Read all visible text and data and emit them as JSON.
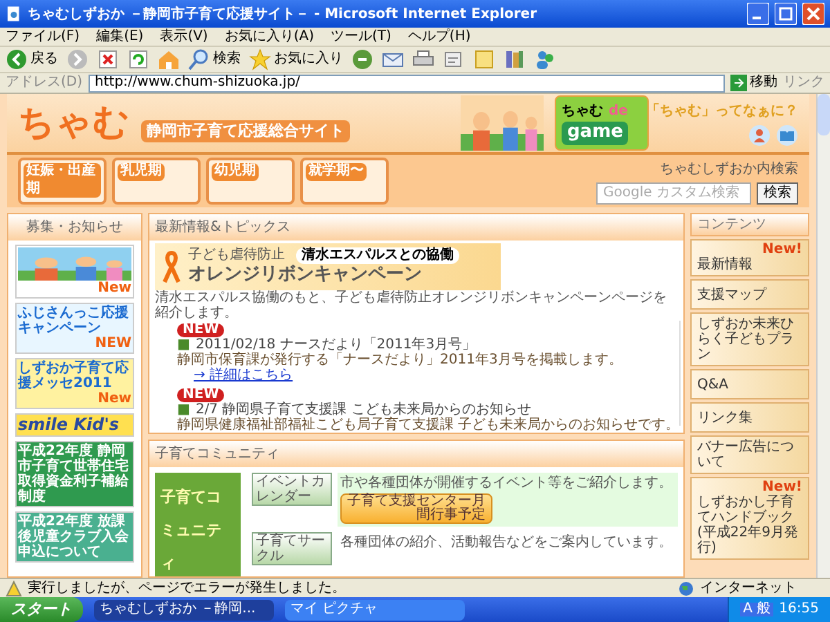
{
  "window": {
    "title": "ちゃむしずおか －静岡市子育て応援サイト－ - Microsoft Internet Explorer"
  },
  "menu": [
    "ファイル(F)",
    "編集(E)",
    "表示(V)",
    "お気に入り(A)",
    "ツール(T)",
    "ヘルプ(H)"
  ],
  "toolbar": [
    {
      "kind": "back",
      "label": "戻る"
    },
    {
      "kind": "forward"
    },
    {
      "kind": "stop"
    },
    {
      "kind": "refresh"
    },
    {
      "kind": "home"
    },
    {
      "kind": "search",
      "label": "検索"
    },
    {
      "kind": "favorites",
      "label": "お気に入り"
    },
    {
      "kind": "media"
    },
    {
      "kind": "mail"
    },
    {
      "kind": "print"
    },
    {
      "kind": "edit"
    },
    {
      "kind": "note"
    },
    {
      "kind": "research"
    },
    {
      "kind": "messenger"
    }
  ],
  "address": {
    "label": "アドレス(D)",
    "url": "http://www.chum-shizuoka.jp/",
    "go": "移動",
    "links": "リンク"
  },
  "header": {
    "logo": "ちゃむ",
    "subtitle": "静岡市子育て応援総合サイト",
    "game_title": "ちゃむ",
    "game_de": "de",
    "game_word": "game",
    "about": "「ちゃむ」ってなぁに？"
  },
  "nav": [
    "妊娠・出産期",
    "乳児期",
    "幼児期",
    "就学期〜"
  ],
  "search": {
    "label": "ちゃむしずおか内検索",
    "placeholder": "Google カスタム検索",
    "button": "検索"
  },
  "left": {
    "title": "募集・お知らせ",
    "banners": [
      {
        "kind": "picture",
        "badge": "New"
      },
      {
        "kind": "text",
        "text": "ふじさんっこ応援キャンペーン",
        "badge": "NEW"
      },
      {
        "kind": "text",
        "text": "しずおか子育て応援メッセ2011",
        "badge": "New"
      },
      {
        "kind": "smile",
        "text": "smile Kid's"
      },
      {
        "kind": "text",
        "text": "平成22年度 静岡市子育て世帯住宅取得資金利子補給制度"
      },
      {
        "kind": "text",
        "text": "平成22年度 放課後児童クラブ入会申込について"
      }
    ]
  },
  "topics": {
    "title": "最新情報&トピックス",
    "campaign": {
      "lead": "子ども虐待防止",
      "partner": "清水エスパルスとの協働",
      "title": "オレンジリボンキャンペーン",
      "caption": "清水エスパルス協働のもと、子ども虐待防止オレンジリボンキャンペーンページを紹介します。"
    },
    "news": [
      {
        "badge": "NEW",
        "marker": "■",
        "headline": "2011/02/18 ナースだより「2011年3月号」",
        "body": "静岡市保育課が発行する「ナースだより」2011年3月号を掲載します。",
        "link": "→ 詳細はこちら"
      },
      {
        "badge": "NEW",
        "marker": "■",
        "headline": "2/7 静岡県子育て支援課 こども未来局からのお知らせ",
        "body": "静岡県健康福祉部福祉こども局子育て支援課 子ども未来局からのお知らせです。"
      }
    ]
  },
  "community": {
    "title": "子育てコミュニティ",
    "image_text": "子育てコミュニティ",
    "rows": [
      {
        "button": "イベントカレンダー",
        "text": "市や各種団体が開催するイベント等をご紹介します。",
        "banner": "子育て支援センター月間行事予定"
      },
      {
        "button": "子育てサークル",
        "text": "各種団体の紹介、活動報告などをご案内しています。"
      }
    ]
  },
  "contents": {
    "title": "コンテンツ",
    "items": [
      {
        "label": "最新情報",
        "badge": "New!"
      },
      {
        "label": "支援マップ"
      },
      {
        "label": "しずおか未来ひらく子どもプラン"
      },
      {
        "label": "Q&A"
      },
      {
        "label": "リンク集"
      },
      {
        "label": "バナー広告について"
      },
      {
        "label": "しずおかし子育てハンドブック",
        "note": "(平成22年9月発行)",
        "badge": "New!"
      }
    ]
  },
  "status": {
    "message": "実行しましたが、ページでエラーが発生しました。",
    "zone": "インターネット"
  },
  "taskbar": {
    "start": "スタート",
    "tasks": [
      {
        "label": "ちゃむしずおか －静岡...",
        "selected": true
      },
      {
        "label": "マイ ピクチャ",
        "selected": false
      }
    ],
    "ime": "A 般",
    "time": "16:55"
  }
}
